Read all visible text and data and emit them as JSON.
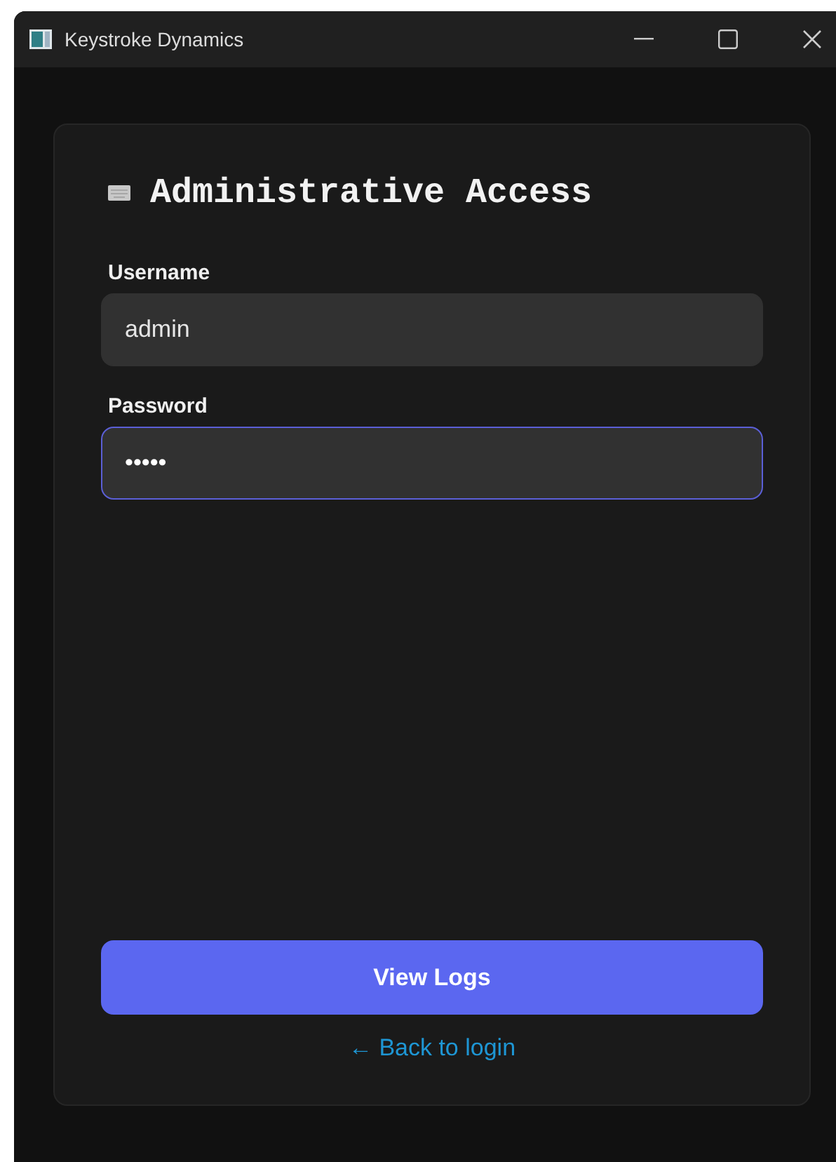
{
  "window": {
    "title": "Keystroke Dynamics"
  },
  "heading": "Administrative Access",
  "fields": [
    {
      "label": "Username",
      "value": "admin",
      "focused": false
    },
    {
      "label": "Password",
      "value": "•••••",
      "focused": true
    }
  ],
  "button": "View Logs",
  "link": "← Back to login"
}
